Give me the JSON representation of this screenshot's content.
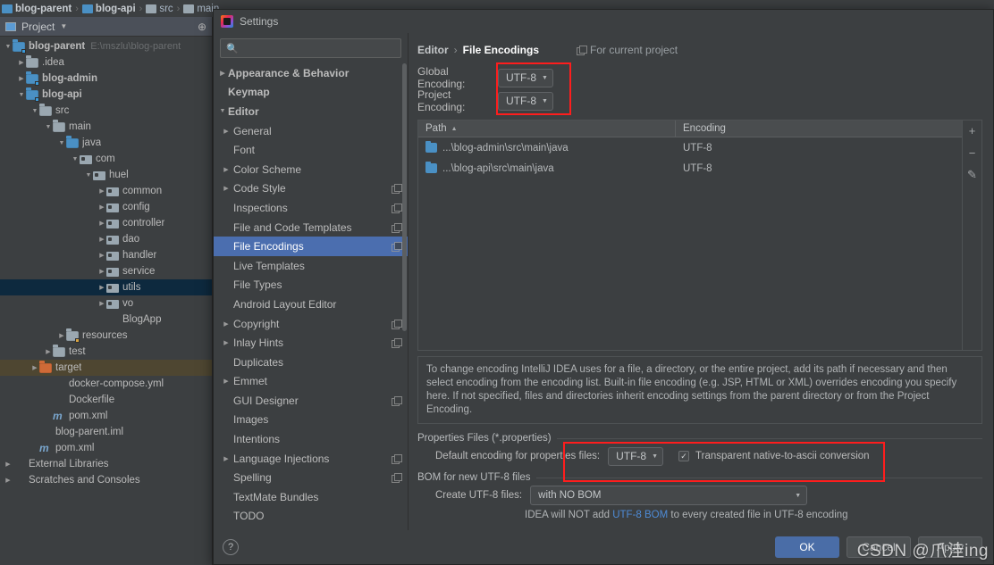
{
  "breadcrumb": {
    "items": [
      {
        "label": "blog-parent",
        "bold": true
      },
      {
        "label": "blog-api",
        "bold": true
      },
      {
        "label": "src",
        "bold": false
      },
      {
        "label": "main",
        "bold": false
      }
    ],
    "separator": "›"
  },
  "project_panel": {
    "title": "Project",
    "caret": "▼",
    "locate_icon": "crosshair-icon",
    "tree": [
      {
        "indent": 0,
        "arrow": "▼",
        "icon": "module-folder",
        "label": "blog-parent",
        "bold": true,
        "sub": "E:\\mszlu\\blog-parent",
        "state": "normal"
      },
      {
        "indent": 1,
        "arrow": "▶",
        "icon": "folder",
        "label": ".idea",
        "bold": false,
        "sub": "",
        "state": "normal"
      },
      {
        "indent": 1,
        "arrow": "▶",
        "icon": "module-folder",
        "label": "blog-admin",
        "bold": true,
        "sub": "",
        "state": "normal"
      },
      {
        "indent": 1,
        "arrow": "▼",
        "icon": "module-folder",
        "label": "blog-api",
        "bold": true,
        "sub": "",
        "state": "normal"
      },
      {
        "indent": 2,
        "arrow": "▼",
        "icon": "folder",
        "label": "src",
        "bold": false,
        "sub": "",
        "state": "normal"
      },
      {
        "indent": 3,
        "arrow": "▼",
        "icon": "folder",
        "label": "main",
        "bold": false,
        "sub": "",
        "state": "normal"
      },
      {
        "indent": 4,
        "arrow": "▼",
        "icon": "source-folder",
        "label": "java",
        "bold": false,
        "sub": "",
        "state": "normal"
      },
      {
        "indent": 5,
        "arrow": "▼",
        "icon": "package",
        "label": "com",
        "bold": false,
        "sub": "",
        "state": "normal"
      },
      {
        "indent": 6,
        "arrow": "▼",
        "icon": "package",
        "label": "huel",
        "bold": false,
        "sub": "",
        "state": "normal"
      },
      {
        "indent": 7,
        "arrow": "▶",
        "icon": "package",
        "label": "common",
        "bold": false,
        "sub": "",
        "state": "normal"
      },
      {
        "indent": 7,
        "arrow": "▶",
        "icon": "package",
        "label": "config",
        "bold": false,
        "sub": "",
        "state": "normal"
      },
      {
        "indent": 7,
        "arrow": "▶",
        "icon": "package",
        "label": "controller",
        "bold": false,
        "sub": "",
        "state": "normal"
      },
      {
        "indent": 7,
        "arrow": "▶",
        "icon": "package",
        "label": "dao",
        "bold": false,
        "sub": "",
        "state": "normal"
      },
      {
        "indent": 7,
        "arrow": "▶",
        "icon": "package",
        "label": "handler",
        "bold": false,
        "sub": "",
        "state": "normal"
      },
      {
        "indent": 7,
        "arrow": "▶",
        "icon": "package",
        "label": "service",
        "bold": false,
        "sub": "",
        "state": "normal"
      },
      {
        "indent": 7,
        "arrow": "▶",
        "icon": "package",
        "label": "utils",
        "bold": false,
        "sub": "",
        "state": "selected"
      },
      {
        "indent": 7,
        "arrow": "▶",
        "icon": "package",
        "label": "vo",
        "bold": false,
        "sub": "",
        "state": "normal"
      },
      {
        "indent": 7,
        "arrow": "",
        "icon": "spring-class",
        "label": "BlogApp",
        "bold": false,
        "sub": "",
        "state": "normal"
      },
      {
        "indent": 4,
        "arrow": "▶",
        "icon": "resources-folder",
        "label": "resources",
        "bold": false,
        "sub": "",
        "state": "normal"
      },
      {
        "indent": 3,
        "arrow": "▶",
        "icon": "folder",
        "label": "test",
        "bold": false,
        "sub": "",
        "state": "normal"
      },
      {
        "indent": 2,
        "arrow": "▶",
        "icon": "target-folder",
        "label": "target",
        "bold": false,
        "sub": "",
        "state": "highlighted"
      },
      {
        "indent": 3,
        "arrow": "",
        "icon": "docker-file",
        "label": "docker-compose.yml",
        "bold": false,
        "sub": "",
        "state": "normal"
      },
      {
        "indent": 3,
        "arrow": "",
        "icon": "docker-file",
        "label": "Dockerfile",
        "bold": false,
        "sub": "",
        "state": "normal"
      },
      {
        "indent": 3,
        "arrow": "",
        "icon": "maven-file",
        "label": "pom.xml",
        "bold": false,
        "sub": "",
        "state": "normal"
      },
      {
        "indent": 2,
        "arrow": "",
        "icon": "iml-file",
        "label": "blog-parent.iml",
        "bold": false,
        "sub": "",
        "state": "normal"
      },
      {
        "indent": 2,
        "arrow": "",
        "icon": "maven-file",
        "label": "pom.xml",
        "bold": false,
        "sub": "",
        "state": "normal"
      },
      {
        "indent": 0,
        "arrow": "▶",
        "icon": "libraries",
        "label": "External Libraries",
        "bold": false,
        "sub": "",
        "state": "normal"
      },
      {
        "indent": 0,
        "arrow": "▶",
        "icon": "scratches",
        "label": "Scratches and Consoles",
        "bold": false,
        "sub": "",
        "state": "normal"
      }
    ]
  },
  "dialog": {
    "title": "Settings",
    "search": {
      "placeholder": "",
      "value": "",
      "icon": "search-icon"
    },
    "nav_items": [
      {
        "level": 0,
        "arrow": "▶",
        "label": "Appearance & Behavior",
        "copy": false,
        "selected": false
      },
      {
        "level": 0,
        "arrow": "",
        "label": "Keymap",
        "copy": false,
        "selected": false
      },
      {
        "level": 0,
        "arrow": "▼",
        "label": "Editor",
        "copy": false,
        "selected": false
      },
      {
        "level": 1,
        "arrow": "▶",
        "label": "General",
        "copy": false,
        "selected": false
      },
      {
        "level": 1,
        "arrow": "",
        "label": "Font",
        "copy": false,
        "selected": false
      },
      {
        "level": 1,
        "arrow": "▶",
        "label": "Color Scheme",
        "copy": false,
        "selected": false
      },
      {
        "level": 1,
        "arrow": "▶",
        "label": "Code Style",
        "copy": true,
        "selected": false
      },
      {
        "level": 1,
        "arrow": "",
        "label": "Inspections",
        "copy": true,
        "selected": false
      },
      {
        "level": 1,
        "arrow": "",
        "label": "File and Code Templates",
        "copy": true,
        "selected": false
      },
      {
        "level": 1,
        "arrow": "",
        "label": "File Encodings",
        "copy": true,
        "selected": true
      },
      {
        "level": 1,
        "arrow": "",
        "label": "Live Templates",
        "copy": false,
        "selected": false
      },
      {
        "level": 1,
        "arrow": "",
        "label": "File Types",
        "copy": false,
        "selected": false
      },
      {
        "level": 1,
        "arrow": "",
        "label": "Android Layout Editor",
        "copy": false,
        "selected": false
      },
      {
        "level": 1,
        "arrow": "▶",
        "label": "Copyright",
        "copy": true,
        "selected": false
      },
      {
        "level": 1,
        "arrow": "▶",
        "label": "Inlay Hints",
        "copy": true,
        "selected": false
      },
      {
        "level": 1,
        "arrow": "",
        "label": "Duplicates",
        "copy": false,
        "selected": false
      },
      {
        "level": 1,
        "arrow": "▶",
        "label": "Emmet",
        "copy": false,
        "selected": false
      },
      {
        "level": 1,
        "arrow": "",
        "label": "GUI Designer",
        "copy": true,
        "selected": false
      },
      {
        "level": 1,
        "arrow": "",
        "label": "Images",
        "copy": false,
        "selected": false
      },
      {
        "level": 1,
        "arrow": "",
        "label": "Intentions",
        "copy": false,
        "selected": false
      },
      {
        "level": 1,
        "arrow": "▶",
        "label": "Language Injections",
        "copy": true,
        "selected": false
      },
      {
        "level": 1,
        "arrow": "",
        "label": "Spelling",
        "copy": true,
        "selected": false
      },
      {
        "level": 1,
        "arrow": "",
        "label": "TextMate Bundles",
        "copy": false,
        "selected": false
      },
      {
        "level": 1,
        "arrow": "",
        "label": "TODO",
        "copy": false,
        "selected": false
      }
    ],
    "content": {
      "breadcrumb_parent": "Editor",
      "breadcrumb_sep": "›",
      "breadcrumb_current": "File Encodings",
      "for_current_project": "For current project",
      "global_encoding_label": "Global Encoding:",
      "global_encoding_value": "UTF-8",
      "project_encoding_label": "Project Encoding:",
      "project_encoding_value": "UTF-8",
      "table": {
        "columns": [
          "Path",
          "Encoding"
        ],
        "sort_indicator": "▲",
        "rows": [
          {
            "path": "...\\blog-admin\\src\\main\\java",
            "encoding": "UTF-8"
          },
          {
            "path": "...\\blog-api\\src\\main\\java",
            "encoding": "UTF-8"
          }
        ],
        "side_buttons": [
          {
            "name": "add-button",
            "glyph": "+"
          },
          {
            "name": "remove-button",
            "glyph": "−"
          },
          {
            "name": "edit-button",
            "glyph": "✎"
          }
        ]
      },
      "description": "To change encoding IntelliJ IDEA uses for a file, a directory, or the entire project, add its path if necessary and then select encoding from the encoding list. Built-in file encoding (e.g. JSP, HTML or XML) overrides encoding you specify here. If not specified, files and directories inherit encoding settings from the parent directory or from the Project Encoding.",
      "properties_group_title": "Properties Files (*.properties)",
      "properties_encoding_label": "Default encoding for properties files:",
      "properties_encoding_value": "UTF-8",
      "transparent_checkbox_label": "Transparent native-to-ascii conversion",
      "transparent_checkbox_checked": true,
      "checkmark": "✓",
      "bom_group_title": "BOM for new UTF-8 files",
      "bom_label": "Create UTF-8 files:",
      "bom_value": "with NO BOM",
      "bom_hint_before": "IDEA will NOT add ",
      "bom_hint_link": "UTF-8 BOM",
      "bom_hint_after": " to every created file in UTF-8 encoding"
    },
    "footer": {
      "help": "?",
      "ok": "OK",
      "cancel": "Cancel",
      "apply": "Apply"
    }
  },
  "watermark": "CSDN @爪洼ing",
  "colors": {
    "accent_selection": "#4b6eaf",
    "highlight_red": "#fe1d1d",
    "link_blue": "#4e8bd6",
    "primary_button": "#4a6da7",
    "tree_selected": "#0d293e",
    "tree_highlight": "#4e4631"
  }
}
